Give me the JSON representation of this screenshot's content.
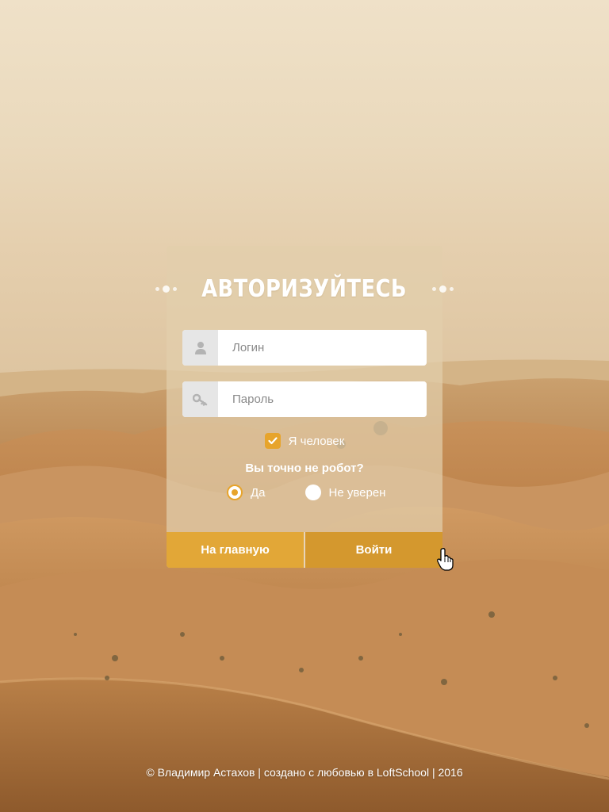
{
  "form": {
    "title": "АВТОРИЗУЙТЕСЬ",
    "login_placeholder": "Логин",
    "password_placeholder": "Пароль",
    "human_label": "Я человек",
    "robot_question": "Вы точно не робот?",
    "radio_yes": "Да",
    "radio_unsure": "Не уверен",
    "human_checked": true,
    "selected_radio": "Да"
  },
  "buttons": {
    "home_label": "На главную",
    "login_label": "Войти"
  },
  "footer": {
    "text": "© Владимир Астахов | создано с любовью в LoftSchool | 2016"
  },
  "icons": {
    "login_icon": "user-icon",
    "password_icon": "key-icon",
    "check_icon": "check-icon",
    "cursor_icon": "hand-pointer-icon"
  },
  "colors": {
    "accent": "#e7a42b",
    "home_button": "#e2a737",
    "login_button": "#d4982e"
  }
}
